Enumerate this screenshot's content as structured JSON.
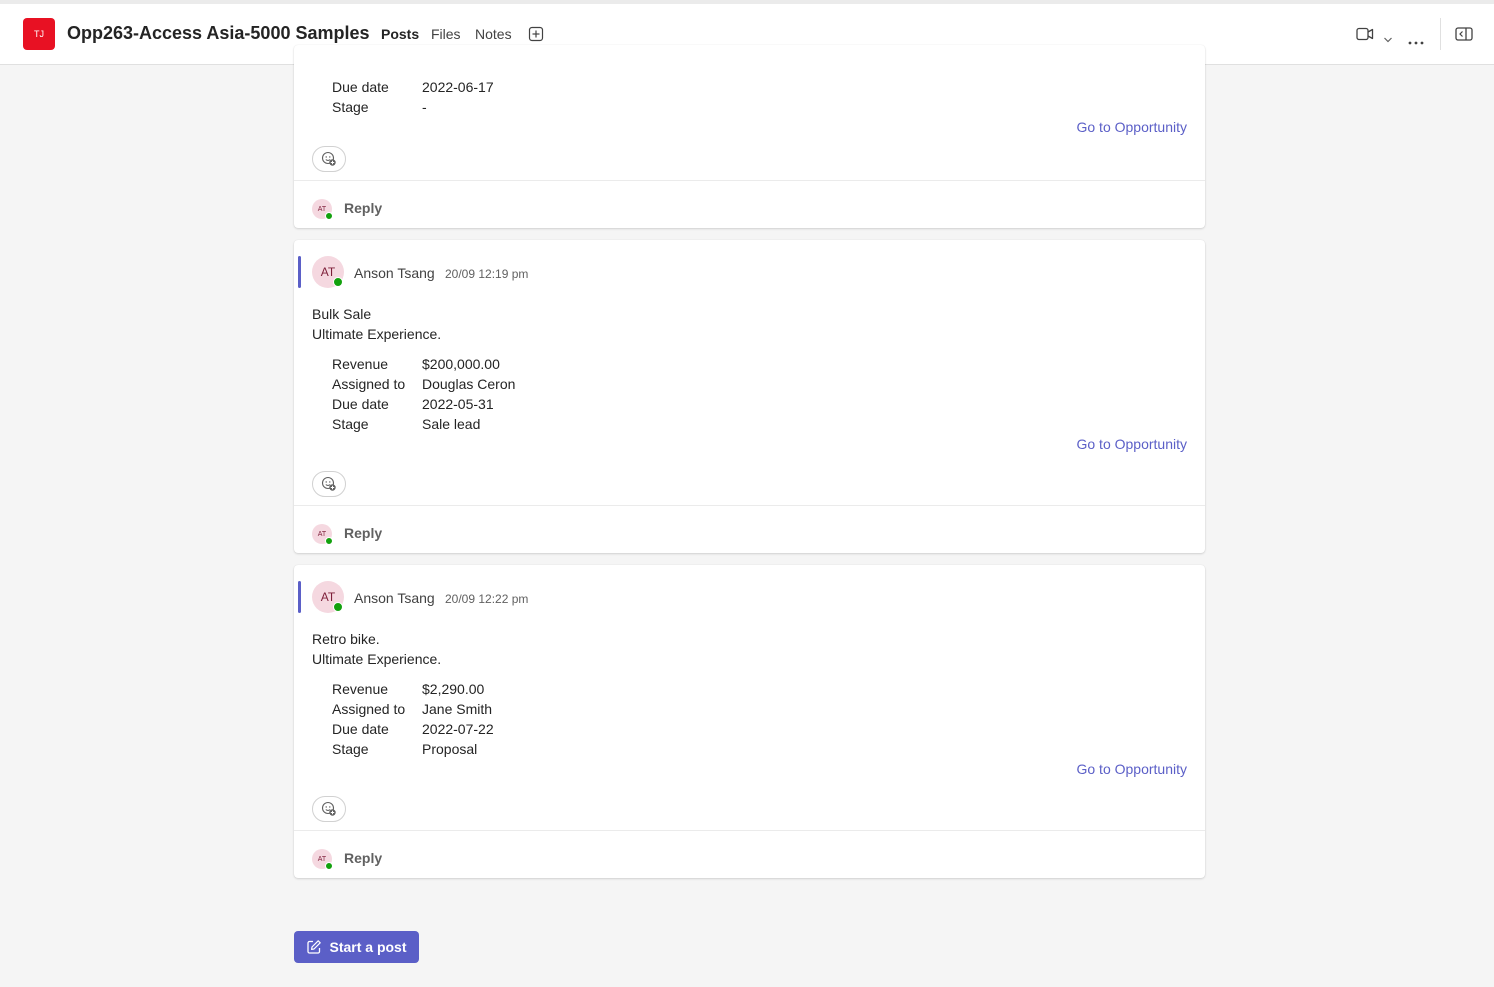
{
  "header": {
    "team_initials": "TJ",
    "channel_title": "Opp263-Access Asia-5000 Samples",
    "tabs": [
      {
        "label": "Posts",
        "active": true
      },
      {
        "label": "Files",
        "active": false
      },
      {
        "label": "Notes",
        "active": false
      }
    ],
    "icons": [
      "add-tab-icon",
      "video-call-icon",
      "chevron-down-icon",
      "more-options-icon",
      "open-side-panel-icon"
    ]
  },
  "colors": {
    "accent": "#5b5fc7",
    "team_avatar": "#e81123",
    "presence_available": "#13a10e",
    "user_avatar_bg": "#f5d8e0"
  },
  "cards": [
    {
      "partial": true,
      "facts": [
        {
          "label": "Due date",
          "value": "2022-06-17"
        },
        {
          "label": "Stage",
          "value": "-"
        }
      ],
      "link": "Go to Opportunity",
      "reply_initials": "AT",
      "reply_label": "Reply"
    },
    {
      "author_initials": "AT",
      "author": "Anson Tsang",
      "timestamp": "20/09 12:19 pm",
      "lines": [
        "Bulk Sale",
        "Ultimate Experience."
      ],
      "facts": [
        {
          "label": "Revenue",
          "value": "$200,000.00"
        },
        {
          "label": "Assigned to",
          "value": "Douglas Ceron"
        },
        {
          "label": "Due date",
          "value": "2022-05-31"
        },
        {
          "label": "Stage",
          "value": "Sale lead"
        }
      ],
      "link": "Go to Opportunity",
      "reply_initials": "AT",
      "reply_label": "Reply"
    },
    {
      "author_initials": "AT",
      "author": "Anson Tsang",
      "timestamp": "20/09 12:22 pm",
      "lines": [
        "Retro bike.",
        "Ultimate Experience."
      ],
      "facts": [
        {
          "label": "Revenue",
          "value": "$2,290.00"
        },
        {
          "label": "Assigned to",
          "value": "Jane Smith"
        },
        {
          "label": "Due date",
          "value": "2022-07-22"
        },
        {
          "label": "Stage",
          "value": "Proposal"
        }
      ],
      "link": "Go to Opportunity",
      "reply_initials": "AT",
      "reply_label": "Reply"
    }
  ],
  "footer": {
    "start_post_label": "Start a post"
  }
}
